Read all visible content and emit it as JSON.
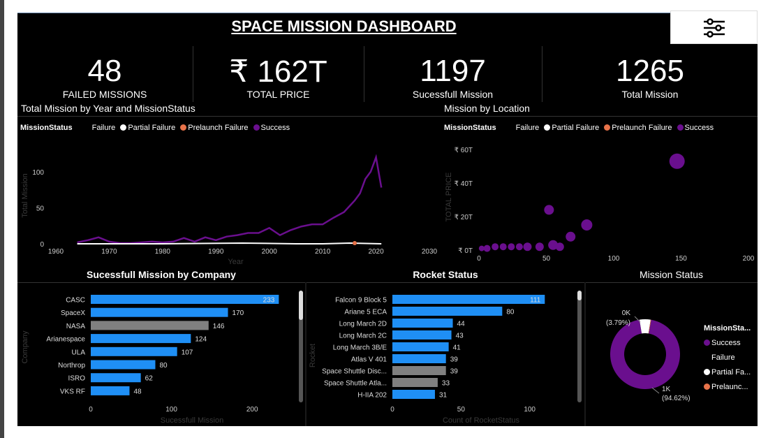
{
  "header": {
    "title": "SPACE MISSION DASHBOARD",
    "filter_icon": "sliders-icon"
  },
  "kpis": [
    {
      "value": "48",
      "label": "FAILED MISSIONS"
    },
    {
      "value": "₹ 162T",
      "label": "TOTAL PRICE"
    },
    {
      "value": "1197",
      "label": "Sucessfull Mission"
    },
    {
      "value": "1265",
      "label": "Total Mission"
    }
  ],
  "colors": {
    "failure": "#1f6fd6",
    "partial": "#ffffff",
    "prelaunch": "#e8734a",
    "success": "#6a0f8e",
    "bar": "#1f8ff5",
    "bar_grey": "#808080"
  },
  "legend": {
    "title": "MissionStatus",
    "items": [
      "Failure",
      "Partial Failure",
      "Prelaunch Failure",
      "Success"
    ]
  },
  "line_chart": {
    "heading": "Total Mission by Year and MissionStatus",
    "chart_data": {
      "type": "line",
      "xlabel": "Year",
      "ylabel": "Total Mission",
      "xlim": [
        1960,
        2030
      ],
      "ylim": [
        0,
        125
      ],
      "x_ticks": [
        "1960",
        "1970",
        "1980",
        "1990",
        "2000",
        "2010",
        "2020",
        "2030"
      ],
      "y_ticks": [
        "0",
        "50",
        "100"
      ],
      "series": [
        {
          "name": "Success",
          "x": [
            1964,
            1966,
            1968,
            1970,
            1972,
            1974,
            1976,
            1978,
            1980,
            1982,
            1984,
            1986,
            1988,
            1990,
            1992,
            1994,
            1996,
            1998,
            2000,
            2002,
            2004,
            2006,
            2008,
            2010,
            2012,
            2014,
            2016,
            2017,
            2018,
            2019,
            2020,
            2021
          ],
          "values": [
            2,
            5,
            9,
            3,
            1,
            1,
            2,
            3,
            2,
            3,
            8,
            3,
            9,
            5,
            10,
            12,
            15,
            15,
            22,
            12,
            19,
            24,
            27,
            27,
            36,
            44,
            60,
            70,
            90,
            100,
            120,
            78
          ]
        },
        {
          "name": "Partial Failure",
          "x": [
            1964,
            1980,
            1995,
            2005,
            2010,
            2015,
            2021
          ],
          "values": [
            0,
            0,
            1,
            0,
            0,
            1,
            0
          ]
        },
        {
          "name": "Prelaunch Failure",
          "x": [
            2016
          ],
          "values": [
            1
          ]
        }
      ]
    }
  },
  "scatter_chart": {
    "heading": "Mission by Location",
    "chart_data": {
      "type": "scatter",
      "ylabel": "TOTAL PRICE",
      "xlim": [
        0,
        200
      ],
      "ylim": [
        0,
        65
      ],
      "x_ticks": [
        "0",
        "50",
        "100",
        "150",
        "200"
      ],
      "y_ticks": [
        "₹ 0T",
        "₹ 20T",
        "₹ 40T",
        "₹ 60T"
      ],
      "points": [
        {
          "x": 147,
          "y": 53,
          "r": 11
        },
        {
          "x": 52,
          "y": 24,
          "r": 7
        },
        {
          "x": 80,
          "y": 15,
          "r": 8
        },
        {
          "x": 68,
          "y": 8,
          "r": 7
        },
        {
          "x": 55,
          "y": 3,
          "r": 7
        },
        {
          "x": 60,
          "y": 2,
          "r": 6
        },
        {
          "x": 45,
          "y": 2,
          "r": 6
        },
        {
          "x": 36,
          "y": 2,
          "r": 6
        },
        {
          "x": 30,
          "y": 2,
          "r": 5
        },
        {
          "x": 24,
          "y": 2,
          "r": 5
        },
        {
          "x": 18,
          "y": 2,
          "r": 5
        },
        {
          "x": 12,
          "y": 2,
          "r": 5
        },
        {
          "x": 6,
          "y": 1,
          "r": 5
        },
        {
          "x": 2,
          "y": 1,
          "r": 4
        }
      ]
    }
  },
  "company_chart": {
    "heading": "Sucessfull Mission by Company",
    "chart_data": {
      "type": "bar",
      "xlabel": "Sucessfull Mission",
      "ylabel": "Company",
      "xlim": [
        0,
        250
      ],
      "x_ticks": [
        "0",
        "100",
        "200"
      ],
      "categories": [
        "CASC",
        "SpaceX",
        "NASA",
        "Arianespace",
        "ULA",
        "Northrop",
        "ISRO",
        "VKS RF"
      ],
      "values": [
        233,
        170,
        146,
        124,
        107,
        80,
        62,
        48
      ],
      "grey": [
        false,
        false,
        true,
        false,
        false,
        false,
        false,
        false
      ]
    }
  },
  "rocket_chart": {
    "heading": "Rocket Status",
    "chart_data": {
      "type": "bar",
      "xlabel": "Count of RocketStatus",
      "ylabel": "Rocket",
      "xlim": [
        0,
        120
      ],
      "x_ticks": [
        "0",
        "50",
        "100"
      ],
      "categories": [
        "Falcon 9 Block 5",
        "Ariane 5 ECA",
        "Long March 2D",
        "Long March 2C",
        "Long March 3B/E",
        "Atlas V 401",
        "Space Shuttle Disc...",
        "Space Shuttle Atla...",
        "H-IIA 202"
      ],
      "values": [
        111,
        80,
        44,
        43,
        41,
        39,
        39,
        33,
        31
      ],
      "grey": [
        false,
        false,
        false,
        false,
        false,
        false,
        true,
        true,
        false
      ]
    }
  },
  "donut_chart": {
    "heading": "Mission Status",
    "chart_data": {
      "type": "pie",
      "labels": [
        "Success",
        "Failure",
        "Partial Failure",
        "Prelaunch Failure"
      ],
      "values": [
        1197,
        0,
        65,
        3
      ],
      "label_big": "1K",
      "label_big_pct": "(94.62%)",
      "label_small": "0K",
      "label_small_pct": "(3.79%)"
    },
    "legend_title": "MissionSta...",
    "legend_items": [
      "Success",
      "Failure",
      "Partial Fa...",
      "Prelaunc..."
    ]
  }
}
